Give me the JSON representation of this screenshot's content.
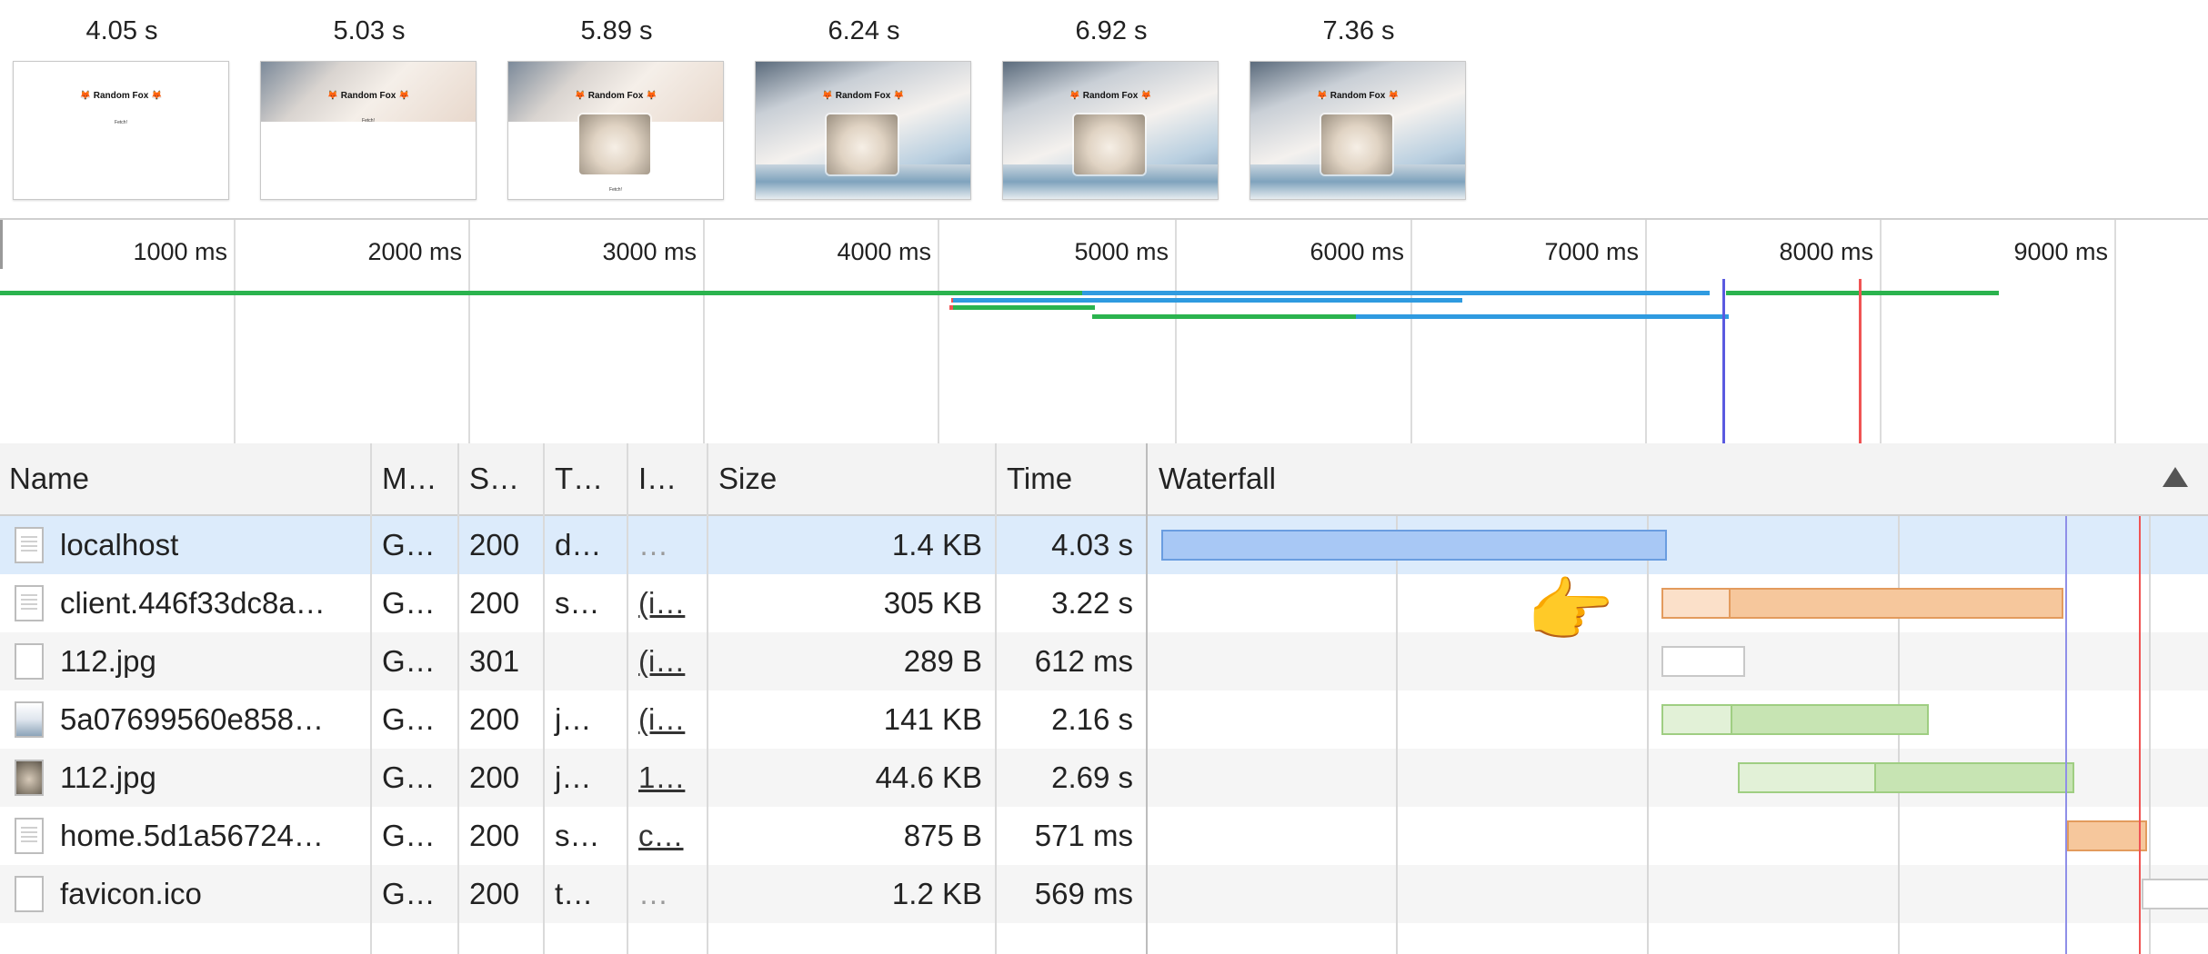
{
  "filmstrip": [
    {
      "time": "4.05 s",
      "title": "Random Fox",
      "fetch_label": "Fetch!"
    },
    {
      "time": "5.03 s",
      "title": "Random Fox",
      "fetch_label": "Fetch!"
    },
    {
      "time": "5.89 s",
      "title": "Random Fox",
      "fetch_label": "Fetch!"
    },
    {
      "time": "6.24 s",
      "title": "Random Fox"
    },
    {
      "time": "6.92 s",
      "title": "Random Fox"
    },
    {
      "time": "7.36 s",
      "title": "Random Fox"
    }
  ],
  "overview": {
    "ticks": [
      "1000 ms",
      "2000 ms",
      "3000 ms",
      "4000 ms",
      "5000 ms",
      "6000 ms",
      "7000 ms",
      "8000 ms",
      "9000 ms"
    ],
    "colors": {
      "green": "#2bb34e",
      "blue": "#2f9be0",
      "dom_content_loaded": "#5a5ae0",
      "load": "#f05454"
    }
  },
  "table": {
    "columns": [
      "Name",
      "M…",
      "S…",
      "T…",
      "I…",
      "Size",
      "Time",
      "Waterfall"
    ],
    "rows": [
      {
        "icon": "document-icon",
        "name": "localhost",
        "method": "G…",
        "status": "200",
        "type": "d…",
        "initiator": "…",
        "size": "1.4 KB",
        "time": "4.03 s"
      },
      {
        "icon": "script-file-icon",
        "name": "client.446f33dc8a…",
        "method": "G…",
        "status": "200",
        "type": "s…",
        "initiator": "(i…",
        "size": "305 KB",
        "time": "3.22 s"
      },
      {
        "icon": "blank-file-icon",
        "name": "112.jpg",
        "method": "G…",
        "status": "301",
        "type": "",
        "initiator": "(i…",
        "size": "289 B",
        "time": "612 ms"
      },
      {
        "icon": "image-thumbnail-icon",
        "name": "5a07699560e858…",
        "method": "G…",
        "status": "200",
        "type": "j…",
        "initiator": "(i…",
        "size": "141 KB",
        "time": "2.16 s"
      },
      {
        "icon": "image-thumbnail-icon",
        "name": "112.jpg",
        "method": "G…",
        "status": "200",
        "type": "j…",
        "initiator": "1…",
        "size": "44.6 KB",
        "time": "2.69 s"
      },
      {
        "icon": "script-file-icon",
        "name": "home.5d1a56724…",
        "method": "G…",
        "status": "200",
        "type": "s…",
        "initiator": "c…",
        "size": "875 B",
        "time": "571 ms"
      },
      {
        "icon": "blank-file-icon",
        "name": "favicon.ico",
        "method": "G…",
        "status": "200",
        "type": "t…",
        "initiator": "…",
        "size": "1.2 KB",
        "time": "569 ms"
      }
    ]
  },
  "waterfall_colors": {
    "document": "#a8c8f5",
    "script": "#f6c79c",
    "redirect": "#ffffff",
    "image": "#c7e4b3"
  },
  "pointer_emoji": "👉"
}
